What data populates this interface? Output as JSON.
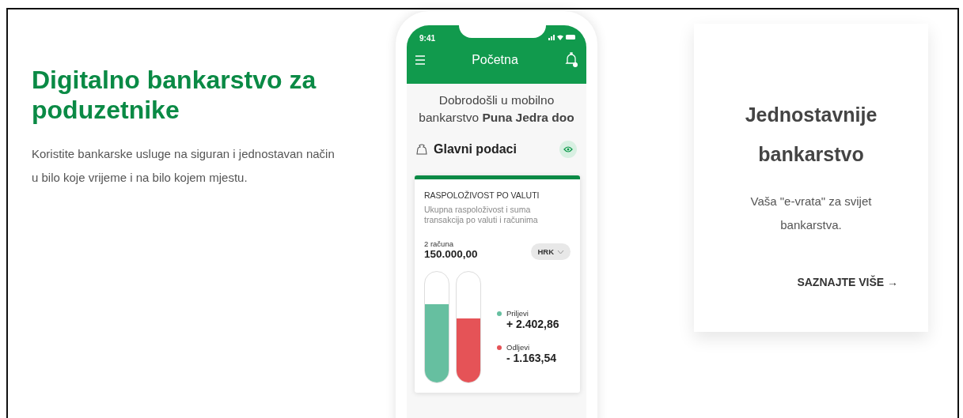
{
  "hero": {
    "title": "Digitalno bankarstvo za poduzetnike",
    "text": "Koristite bankarske usluge na siguran i jednostavan način u bilo koje vrijeme i na bilo kojem mjestu."
  },
  "phone": {
    "status_time": "9:41",
    "header_title": "Početna",
    "welcome": "Dobrodošli u mobilno bankarstvo **Puna Jedra doo**",
    "section_title": "Glavni podaci",
    "card": {
      "title": "RASPOLOŽIVOST PO VALUTI",
      "subtitle": "Ukupna raspoloživost i suma transakcija po valuti i računima",
      "accounts": "2 računa",
      "amount": "150.000,00",
      "currency": "HRK",
      "flows": [
        {
          "label": "Priljevi",
          "value": "+ 2.402,86",
          "color": "#66bfa0",
          "level": 0.71
        },
        {
          "label": "Odljevi",
          "value": "- 1.163,54",
          "color": "#e55357",
          "level": 0.58
        }
      ]
    }
  },
  "promo": {
    "title": "Jednostavnije bankarstvo",
    "text": "Vaša \"e-vrata\" za svijet bankarstva.",
    "link": "SAZNAJTE VIŠE",
    "link_arrow": "→"
  }
}
